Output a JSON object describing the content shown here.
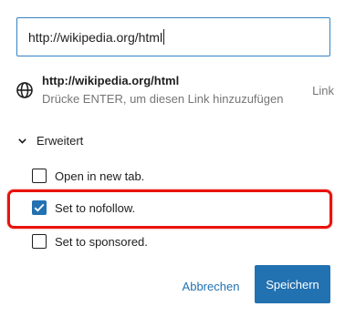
{
  "link_input": {
    "value": "http://wikipedia.org/html"
  },
  "suggestion": {
    "icon": "globe-icon",
    "url": "http://wikipedia.org/html",
    "hint": "Drücke ENTER, um diesen Link hinzuzufügen",
    "type_label": "Link"
  },
  "advanced": {
    "label": "Erweitert",
    "expanded": true,
    "options": [
      {
        "label": "Open in new tab.",
        "checked": false
      },
      {
        "label": "Set to nofollow.",
        "checked": true
      },
      {
        "label": "Set to sponsored.",
        "checked": false
      }
    ]
  },
  "actions": {
    "cancel_label": "Abbrechen",
    "save_label": "Speichern"
  },
  "colors": {
    "accent": "#2271b1",
    "focus_border": "#3582c4",
    "highlight": "#e8130c",
    "muted_text": "#757575"
  }
}
